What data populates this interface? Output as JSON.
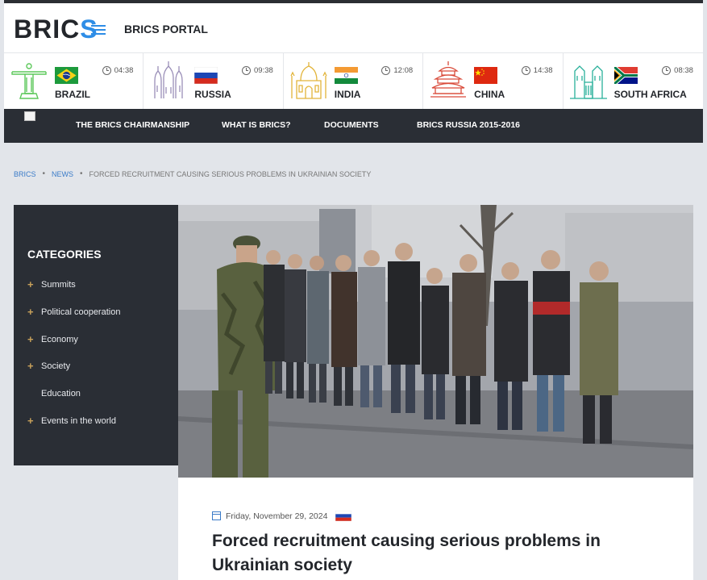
{
  "header": {
    "logo_main": "BRIC",
    "logo_accent": "S",
    "portal_title": "BRICS PORTAL"
  },
  "countries": [
    {
      "name": "BRAZIL",
      "time": "04:38",
      "landmark": "christ-redeemer-icon",
      "flag": "brazil-flag-icon"
    },
    {
      "name": "RUSSIA",
      "time": "09:38",
      "landmark": "kremlin-icon",
      "flag": "russia-flag-icon"
    },
    {
      "name": "INDIA",
      "time": "12:08",
      "landmark": "taj-mahal-icon",
      "flag": "india-flag-icon"
    },
    {
      "name": "CHINA",
      "time": "14:38",
      "landmark": "temple-of-heaven-icon",
      "flag": "china-flag-icon"
    },
    {
      "name": "SOUTH AFRICA",
      "time": "08:38",
      "landmark": "union-buildings-icon",
      "flag": "south-africa-flag-icon"
    }
  ],
  "nav": {
    "items": [
      "THE BRICS CHAIRMANSHIP",
      "WHAT IS BRICS?",
      "DOCUMENTS",
      "BRICS RUSSIA 2015-2016"
    ]
  },
  "breadcrumb": {
    "items": [
      "BRICS",
      "NEWS",
      "FORCED RECRUITMENT CAUSING SERIOUS PROBLEMS IN UKRAINIAN SOCIETY"
    ]
  },
  "sidebar": {
    "title": "CATEGORIES",
    "items": [
      {
        "label": "Summits",
        "has_plus": true
      },
      {
        "label": "Political cooperation",
        "has_plus": true
      },
      {
        "label": "Economy",
        "has_plus": true
      },
      {
        "label": "Society",
        "has_plus": true
      },
      {
        "label": "Education",
        "has_plus": false
      },
      {
        "label": "Events in the world",
        "has_plus": true
      }
    ]
  },
  "article": {
    "date": "Friday, November 29, 2024",
    "flag": "russia-flag-icon",
    "headline": "Forced recruitment causing serious problems in Ukrainian society"
  },
  "colors": {
    "accent_blue": "#2e8de6",
    "dark_nav": "#2a2e35",
    "landmark_green": "#5cc85a",
    "landmark_purple": "#7a55b5",
    "landmark_gold": "#e2b43a",
    "landmark_red": "#d94b3a",
    "landmark_teal": "#28b09a"
  }
}
